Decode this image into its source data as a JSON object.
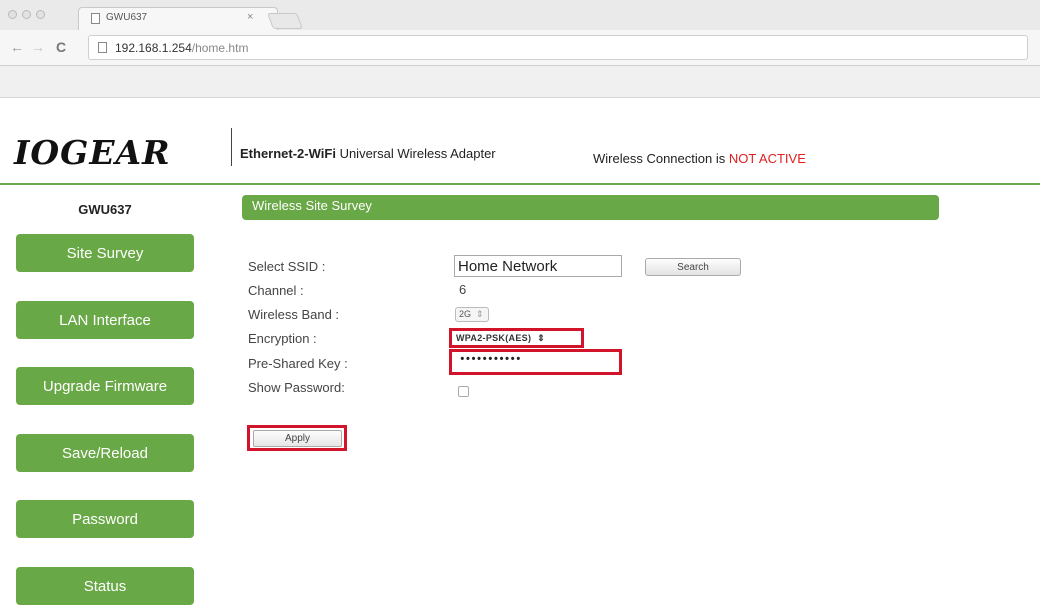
{
  "browser": {
    "tab_title": "GWU637",
    "tab_close": "×",
    "url_host": "192.168.1.254",
    "url_path": "/home.htm"
  },
  "header": {
    "logo_text": "IOGEAR",
    "product_bold": "Ethernet-2-WiFi",
    "product_rest": " Universal Wireless Adapter",
    "status_prefix": "Wireless Connection is ",
    "status_value": "NOT ACTIVE",
    "status_color": "#e02020",
    "accent_color": "#69a846"
  },
  "sidebar": {
    "model": "GWU637",
    "items": [
      {
        "label": "Site Survey"
      },
      {
        "label": "LAN Interface"
      },
      {
        "label": "Upgrade Firmware"
      },
      {
        "label": "Save/Reload"
      },
      {
        "label": "Password"
      },
      {
        "label": "Status"
      }
    ]
  },
  "main": {
    "section_title": "Wireless Site Survey",
    "ssid_label": "Select SSID :",
    "ssid_value": "Home Network",
    "search_label": "Search",
    "channel_label": "Channel :",
    "channel_value": "6",
    "band_label": "Wireless Band :",
    "band_value": "2G",
    "encryption_label": "Encryption :",
    "encryption_value": "WPA2-PSK(AES)",
    "psk_label": "Pre-Shared Key :",
    "psk_value": "•••••••••••",
    "show_password_label": "Show Password:",
    "apply_label": "Apply"
  }
}
